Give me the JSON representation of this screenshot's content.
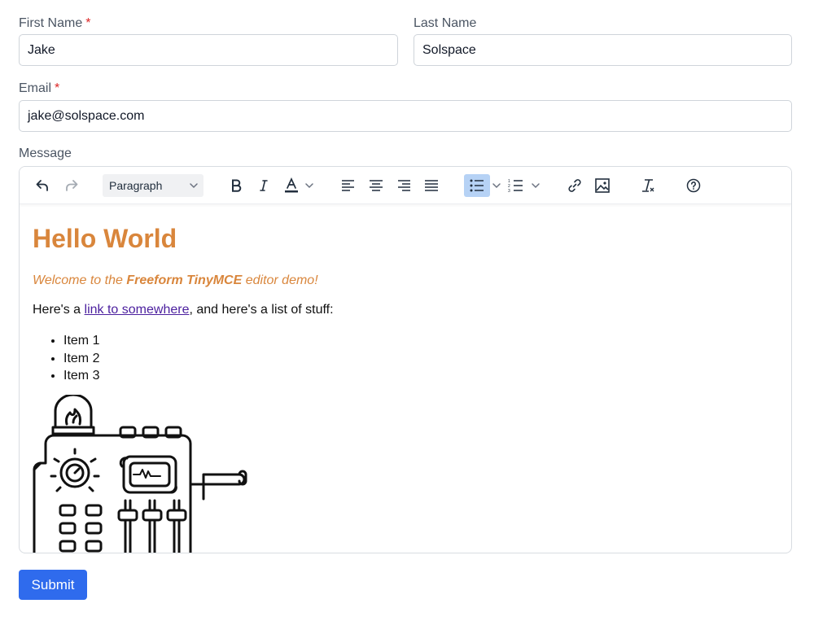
{
  "form": {
    "first_name": {
      "label": "First Name",
      "required_mark": "*",
      "value": "Jake"
    },
    "last_name": {
      "label": "Last Name",
      "value": "Solspace"
    },
    "email": {
      "label": "Email",
      "required_mark": "*",
      "value": "jake@solspace.com"
    },
    "message": {
      "label": "Message"
    },
    "submit_label": "Submit"
  },
  "toolbar": {
    "block_format": "Paragraph",
    "icons": [
      "undo-icon",
      "redo-icon",
      "bold-icon",
      "italic-icon",
      "text-color-icon",
      "align-left-icon",
      "align-center-icon",
      "align-right-icon",
      "justify-icon",
      "bullet-list-icon",
      "numbered-list-icon",
      "link-icon",
      "image-icon",
      "clear-formatting-icon",
      "help-icon"
    ],
    "active": "bullet-list"
  },
  "editor_content": {
    "heading": "Hello World",
    "intro_prefix": "Welcome to the ",
    "intro_bold": "Freeform TinyMCE",
    "intro_suffix": " editor demo!",
    "para_prefix": "Here's a ",
    "link_text": "link to somewhere",
    "para_suffix": ", and here's a list of stuff:",
    "list_items": [
      "Item 1",
      "Item 2",
      "Item 3"
    ]
  },
  "colors": {
    "accent_orange": "#d9863c",
    "link_purple": "#4b1f9e",
    "primary_button": "#2f6bed",
    "required_red": "#dc2626",
    "active_tool": "#b6d2f5"
  }
}
